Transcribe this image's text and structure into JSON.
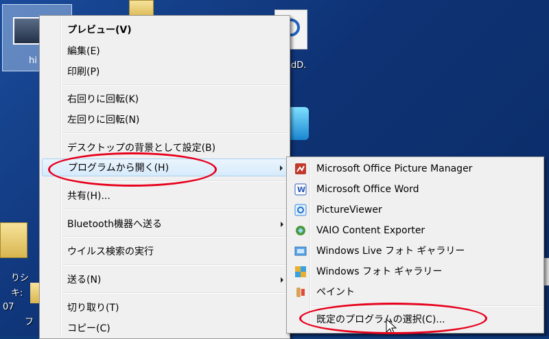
{
  "desktop": {
    "icon_labels": [
      "hi",
      "dD.",
      "りシ",
      "キ:",
      "07",
      "フ"
    ]
  },
  "context_menu": {
    "items": [
      {
        "label": "プレビュー(V)",
        "bold": true
      },
      {
        "label": "編集(E)"
      },
      {
        "label": "印刷(P)"
      },
      {
        "label": "右回りに回転(K)"
      },
      {
        "label": "左回りに回転(N)"
      },
      {
        "label": "デスクトップの背景として設定(B)"
      },
      {
        "label": "プログラムから開く(H)",
        "submenu": true
      },
      {
        "label": "共有(H)..."
      },
      {
        "label": "Bluetooth機器へ送る",
        "submenu": true
      },
      {
        "label": "ウイルス検索の実行"
      },
      {
        "label": "送る(N)",
        "submenu": true
      },
      {
        "label": "切り取り(T)"
      },
      {
        "label": "コピー(C)"
      }
    ]
  },
  "open_with_submenu": {
    "items": [
      {
        "label": "Microsoft Office Picture Manager",
        "icon": "picture-manager-icon"
      },
      {
        "label": "Microsoft Office Word",
        "icon": "word-icon"
      },
      {
        "label": "PictureViewer",
        "icon": "pictureviewer-icon"
      },
      {
        "label": "VAIO Content Exporter",
        "icon": "vaio-exporter-icon"
      },
      {
        "label": "Windows Live フォト ギャラリー",
        "icon": "live-photo-gallery-icon"
      },
      {
        "label": "Windows フォト ギャラリー",
        "icon": "photo-gallery-icon"
      },
      {
        "label": "ペイント",
        "icon": "paint-icon"
      },
      {
        "label": "既定のプログラムの選択(C)..."
      }
    ]
  },
  "colors": {
    "highlight_ellipse": "#e8001c",
    "menu_background": "#f0f0f0",
    "desktop_background": "#0f3a7a"
  }
}
